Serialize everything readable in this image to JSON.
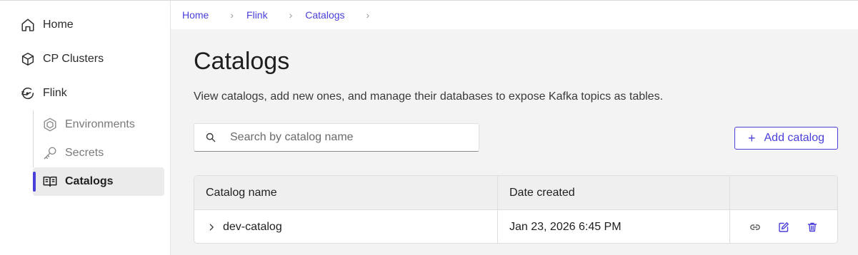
{
  "sidebar": {
    "items": [
      {
        "label": "Home",
        "icon": "home-icon"
      },
      {
        "label": "CP Clusters",
        "icon": "cube-icon"
      },
      {
        "label": "Flink",
        "icon": "flink-icon"
      }
    ],
    "subitems": [
      {
        "label": "Environments",
        "icon": "hexagon-icon",
        "active": false
      },
      {
        "label": "Secrets",
        "icon": "key-icon",
        "active": false
      },
      {
        "label": "Catalogs",
        "icon": "book-icon",
        "active": true
      }
    ]
  },
  "breadcrumb": [
    "Home",
    "Flink",
    "Catalogs"
  ],
  "page": {
    "title": "Catalogs",
    "description": "View catalogs, add new ones, and manage their databases to expose Kafka topics as tables."
  },
  "search": {
    "placeholder": "Search by catalog name",
    "value": ""
  },
  "add_button": {
    "label": "Add catalog"
  },
  "table": {
    "columns": [
      "Catalog name",
      "Date created",
      ""
    ],
    "rows": [
      {
        "name": "dev-catalog",
        "date": "Jan 23, 2026 6:45 PM",
        "actions": [
          "link-icon",
          "edit-icon",
          "trash-icon"
        ]
      }
    ]
  },
  "colors": {
    "accent": "#4a3fd9",
    "background": "#f3f3f3",
    "border": "#dedede"
  }
}
